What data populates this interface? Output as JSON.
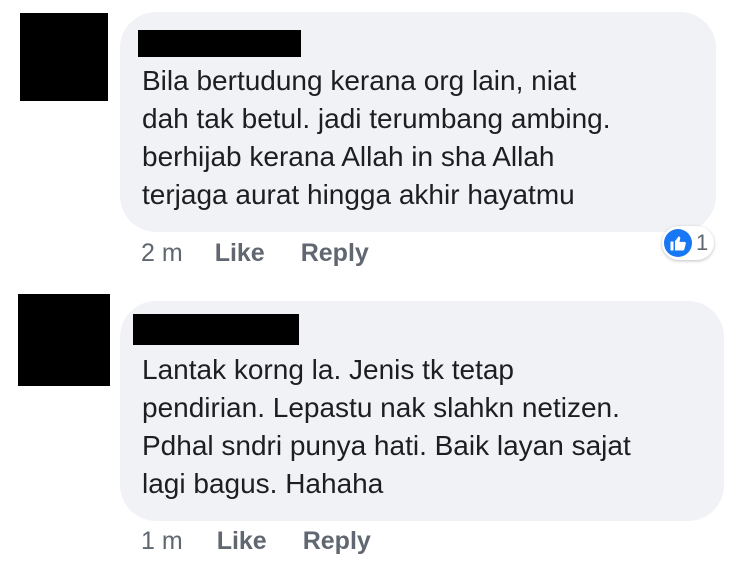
{
  "colors": {
    "bubble": "#f1f2f6",
    "meta_text": "#606770",
    "like_blue": "#1877f2"
  },
  "comments": [
    {
      "text": "Bila bertudung kerana org lain, niat\ndah tak betul. jadi terumbang ambing.\nberhijab kerana Allah in sha Allah\nterjaga aurat hingga akhir hayatmu",
      "time": "2 m",
      "like_label": "Like",
      "reply_label": "Reply",
      "reaction_icon": "thumbs-up-icon",
      "reaction_count": "1"
    },
    {
      "text": "Lantak korng la. Jenis tk tetap\npendirian. Lepastu nak slahkn netizen.\nPdhal sndri punya hati. Baik layan sajat\nlagi bagus. Hahaha",
      "time": "1 m",
      "like_label": "Like",
      "reply_label": "Reply"
    }
  ]
}
